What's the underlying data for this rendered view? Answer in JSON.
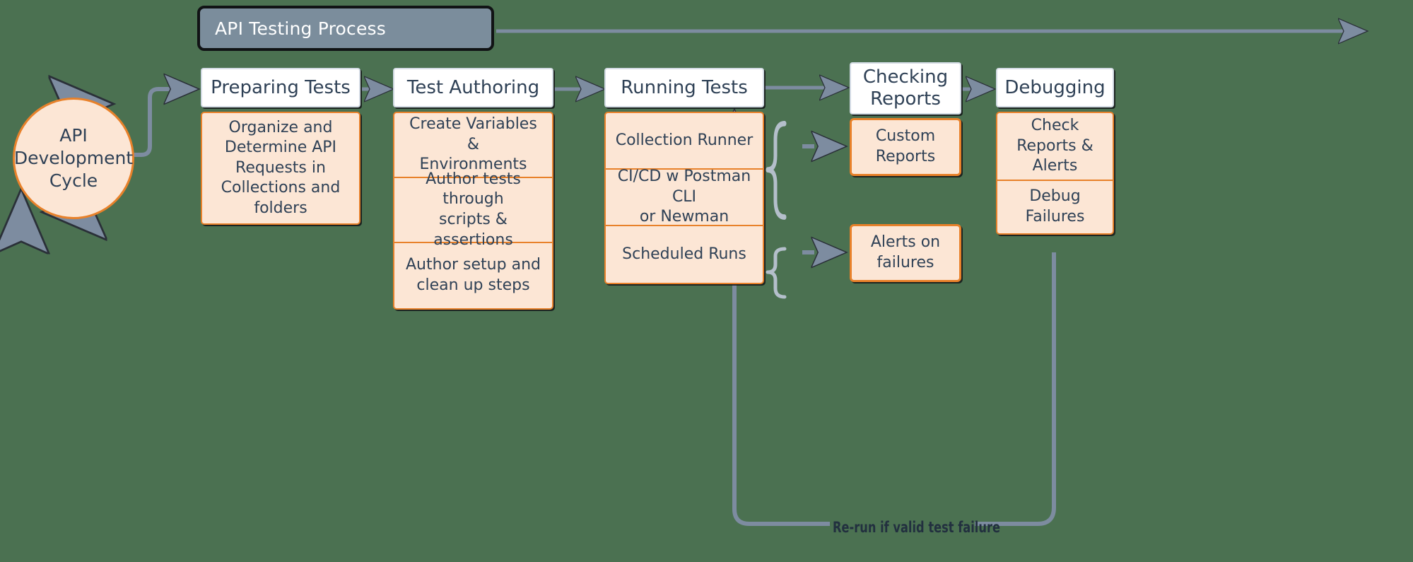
{
  "banner": {
    "title": "API Testing Process",
    "fill": "#7b8d9c",
    "border": "#111315",
    "text_color": "#ffffff"
  },
  "canvas": {
    "background": "#4b7151",
    "accent_orange": "#e8812a",
    "panel_peach": "#fce6d5",
    "ink": "#2f4156",
    "wire": "#7d8ca0"
  },
  "cycle": {
    "label": "API\nDevelopment\nCycle",
    "fill": "#fce6d5",
    "border": "#e8812a"
  },
  "stages": [
    {
      "id": "preparing-tests",
      "header": "Preparing Tests",
      "items": [
        "Organize and\nDetermine API\nRequests in\nCollections and\nfolders"
      ]
    },
    {
      "id": "test-authoring",
      "header": "Test Authoring",
      "items": [
        "Create Variables &\nEnvironments",
        "Author tests through\nscripts & assertions",
        "Author setup and\nclean up steps"
      ]
    },
    {
      "id": "running-tests",
      "header": "Running Tests",
      "items": [
        "Collection Runner",
        "CI/CD w Postman CLI\nor Newman",
        "Scheduled Runs"
      ]
    },
    {
      "id": "checking-reports",
      "header": "Checking\nReports",
      "items": [
        "Custom\nReports"
      ]
    },
    {
      "id": "debugging",
      "header": "Debugging",
      "items": [
        "Check\nReports &\nAlerts",
        "Debug\nFailures"
      ]
    }
  ],
  "side_cards": [
    {
      "id": "custom-reports",
      "label": "Custom\nReports"
    },
    {
      "id": "alerts-on-failures",
      "label": "Alerts on\nfailures"
    }
  ],
  "loop": {
    "label": "Re-run if valid test failure"
  },
  "icons": {
    "arrow_right": "arrow-right-icon",
    "dashed_arrow": "dashed-arrow-icon",
    "curly_brace": "curly-brace-icon",
    "cycle_arrow": "cycle-arrow-icon"
  }
}
